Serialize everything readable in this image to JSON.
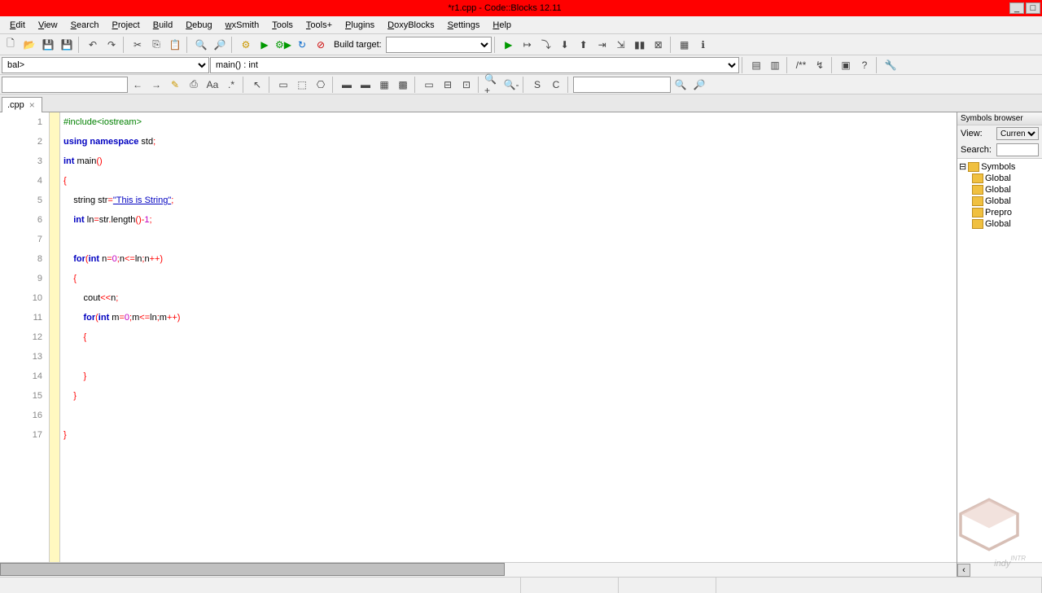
{
  "titlebar": {
    "title": "*r1.cpp - Code::Blocks 12.11"
  },
  "menu": {
    "items": [
      "Edit",
      "View",
      "Search",
      "Project",
      "Build",
      "Debug",
      "wxSmith",
      "Tools",
      "Tools+",
      "Plugins",
      "DoxyBlocks",
      "Settings",
      "Help"
    ]
  },
  "toolbar1": {
    "build_target_label": "Build target:",
    "build_target_value": ""
  },
  "toolbar2": {
    "scope_dropdown": "bal>",
    "function_dropdown": "main() : int"
  },
  "tab": {
    "filename": ".cpp"
  },
  "code_lines": [
    {
      "n": 1,
      "tokens": [
        {
          "t": "#include<iostream>",
          "c": "kw-pp"
        }
      ]
    },
    {
      "n": 2,
      "tokens": [
        {
          "t": "using",
          "c": "kw-blue"
        },
        {
          "t": " ",
          "c": ""
        },
        {
          "t": "namespace",
          "c": "kw-blue"
        },
        {
          "t": " std",
          "c": ""
        },
        {
          "t": ";",
          "c": "op"
        }
      ]
    },
    {
      "n": 3,
      "tokens": [
        {
          "t": "int",
          "c": "kw-blue"
        },
        {
          "t": " main",
          "c": ""
        },
        {
          "t": "()",
          "c": "op"
        }
      ]
    },
    {
      "n": 4,
      "tokens": [
        {
          "t": "{",
          "c": "op"
        }
      ]
    },
    {
      "n": 5,
      "tokens": [
        {
          "t": "    string str",
          "c": ""
        },
        {
          "t": "=",
          "c": "op"
        },
        {
          "t": "\"This is String\"",
          "c": "str"
        },
        {
          "t": ";",
          "c": "op"
        }
      ]
    },
    {
      "n": 6,
      "tokens": [
        {
          "t": "    ",
          "c": ""
        },
        {
          "t": "int",
          "c": "kw-blue"
        },
        {
          "t": " ln",
          "c": ""
        },
        {
          "t": "=",
          "c": "op"
        },
        {
          "t": "str",
          "c": ""
        },
        {
          "t": ".",
          "c": "op"
        },
        {
          "t": "length",
          "c": ""
        },
        {
          "t": "()-",
          "c": "op"
        },
        {
          "t": "1",
          "c": "num"
        },
        {
          "t": ";",
          "c": "op"
        }
      ]
    },
    {
      "n": 7,
      "tokens": []
    },
    {
      "n": 8,
      "tokens": [
        {
          "t": "    ",
          "c": ""
        },
        {
          "t": "for",
          "c": "kw-blue"
        },
        {
          "t": "(",
          "c": "op"
        },
        {
          "t": "int",
          "c": "kw-blue"
        },
        {
          "t": " n",
          "c": ""
        },
        {
          "t": "=",
          "c": "op"
        },
        {
          "t": "0",
          "c": "num"
        },
        {
          "t": ";",
          "c": "op"
        },
        {
          "t": "n",
          "c": ""
        },
        {
          "t": "<=",
          "c": "op"
        },
        {
          "t": "ln",
          "c": ""
        },
        {
          "t": ";",
          "c": "op"
        },
        {
          "t": "n",
          "c": ""
        },
        {
          "t": "++)",
          "c": "op"
        }
      ]
    },
    {
      "n": 9,
      "tokens": [
        {
          "t": "    ",
          "c": ""
        },
        {
          "t": "{",
          "c": "op"
        }
      ]
    },
    {
      "n": 10,
      "tokens": [
        {
          "t": "        cout",
          "c": ""
        },
        {
          "t": "<<",
          "c": "op"
        },
        {
          "t": "n",
          "c": ""
        },
        {
          "t": ";",
          "c": "op"
        }
      ]
    },
    {
      "n": 11,
      "tokens": [
        {
          "t": "        ",
          "c": ""
        },
        {
          "t": "for",
          "c": "kw-blue"
        },
        {
          "t": "(",
          "c": "op"
        },
        {
          "t": "int",
          "c": "kw-blue"
        },
        {
          "t": " m",
          "c": ""
        },
        {
          "t": "=",
          "c": "op"
        },
        {
          "t": "0",
          "c": "num"
        },
        {
          "t": ";",
          "c": "op"
        },
        {
          "t": "m",
          "c": ""
        },
        {
          "t": "<=",
          "c": "op"
        },
        {
          "t": "ln",
          "c": ""
        },
        {
          "t": ";",
          "c": "op"
        },
        {
          "t": "m",
          "c": ""
        },
        {
          "t": "++)",
          "c": "op"
        }
      ]
    },
    {
      "n": 12,
      "tokens": [
        {
          "t": "        ",
          "c": ""
        },
        {
          "t": "{",
          "c": "op"
        }
      ]
    },
    {
      "n": 13,
      "tokens": [
        {
          "t": "            ",
          "c": ""
        }
      ]
    },
    {
      "n": 14,
      "tokens": [
        {
          "t": "        ",
          "c": ""
        },
        {
          "t": "}",
          "c": "op"
        }
      ]
    },
    {
      "n": 15,
      "tokens": [
        {
          "t": "    ",
          "c": ""
        },
        {
          "t": "}",
          "c": "op"
        }
      ]
    },
    {
      "n": 16,
      "tokens": []
    },
    {
      "n": 17,
      "tokens": [
        {
          "t": "}",
          "c": "op"
        }
      ]
    }
  ],
  "symbols_panel": {
    "title": "Symbols browser",
    "view_label": "View:",
    "view_value": "Current file",
    "search_label": "Search:",
    "search_value": "",
    "tree": {
      "root": "Symbols",
      "items": [
        "Global",
        "Global",
        "Global",
        "Prepro",
        "Global"
      ]
    }
  },
  "watermark": {
    "text": "indy",
    "suffix": "INTR"
  }
}
